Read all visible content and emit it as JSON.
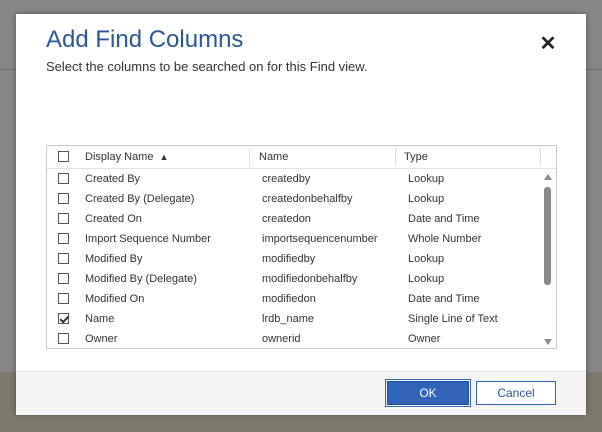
{
  "dialog": {
    "title": "Add Find Columns",
    "subtitle": "Select the columns to be searched on for this Find view.",
    "close_glyph": "✕"
  },
  "grid": {
    "headers": {
      "display_name": "Display Name",
      "display_name_sort_glyph": "▲",
      "name": "Name",
      "type": "Type"
    },
    "select_all_checked": false,
    "rows": [
      {
        "display_name": "Created By",
        "name": "createdby",
        "type": "Lookup",
        "checked": false
      },
      {
        "display_name": "Created By (Delegate)",
        "name": "createdonbehalfby",
        "type": "Lookup",
        "checked": false
      },
      {
        "display_name": "Created On",
        "name": "createdon",
        "type": "Date and Time",
        "checked": false
      },
      {
        "display_name": "Import Sequence Number",
        "name": "importsequencenumber",
        "type": "Whole Number",
        "checked": false
      },
      {
        "display_name": "Modified By",
        "name": "modifiedby",
        "type": "Lookup",
        "checked": false
      },
      {
        "display_name": "Modified By (Delegate)",
        "name": "modifiedonbehalfby",
        "type": "Lookup",
        "checked": false
      },
      {
        "display_name": "Modified On",
        "name": "modifiedon",
        "type": "Date and Time",
        "checked": false
      },
      {
        "display_name": "Name",
        "name": "lrdb_name",
        "type": "Single Line of Text",
        "checked": true
      },
      {
        "display_name": "Owner",
        "name": "ownerid",
        "type": "Owner",
        "checked": false
      }
    ]
  },
  "footer": {
    "ok_label": "OK",
    "cancel_label": "Cancel"
  },
  "colors": {
    "accent": "#2b579a",
    "ok_button": "#2f64b8"
  },
  "icons": [
    "close-icon",
    "sort-ascending-icon",
    "checkbox-icon",
    "scroll-up-arrow-icon",
    "scroll-down-arrow-icon"
  ]
}
